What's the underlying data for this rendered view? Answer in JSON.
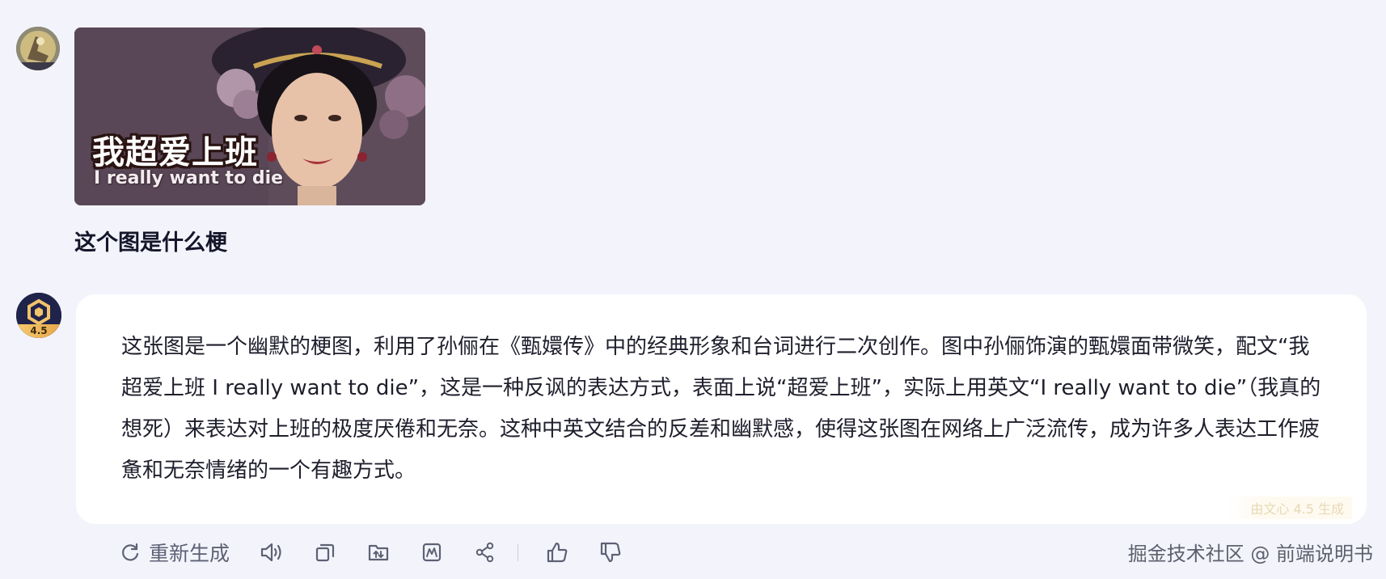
{
  "user": {
    "meme_text_cn": "我超爱上班",
    "meme_text_en": "I really want to die",
    "question": "这个图是什么梗"
  },
  "bot": {
    "avatar_version": "4.5",
    "answer": "这张图是一个幽默的梗图，利用了孙俪在《甄嬛传》中的经典形象和台词进行二次创作。图中孙俪饰演的甄嬛面带微笑，配文“我超爱上班 I really want to die”，这是一种反讽的表达方式，表面上说“超爱上班”，实际上用英文“I really want to die”（我真的想死）来表达对上班的极度厌倦和无奈。这种中英文结合的反差和幽默感，使得这张图在网络上广泛流传，成为许多人表达工作疲惫和无奈情绪的一个有趣方式。",
    "generated_by": "由文心 4.5 生成"
  },
  "actions": {
    "regenerate_label": "重新生成",
    "icons": [
      "refresh-icon",
      "speaker-icon",
      "copy-icon",
      "export-folder-icon",
      "chart-icon",
      "share-icon",
      "thumbs-up-icon",
      "thumbs-down-icon"
    ]
  },
  "watermark": "掘金技术社区 @ 前端说明书",
  "colors": {
    "background": "#f3f4fb",
    "bubble": "#ffffff",
    "icon_gray": "#5d6174",
    "badge_gold": "#f6c96e"
  }
}
